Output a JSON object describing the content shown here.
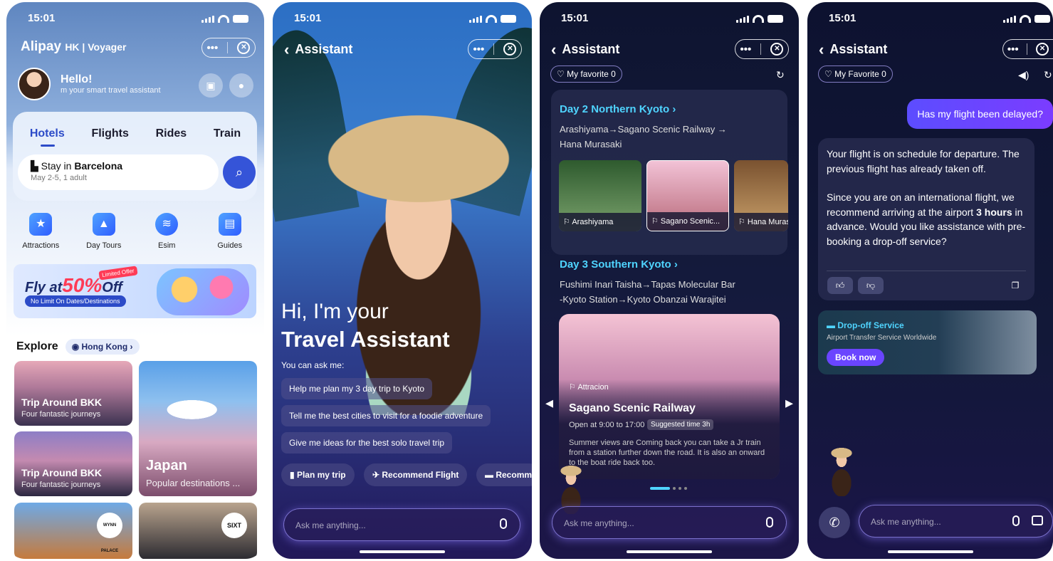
{
  "status": {
    "time": "15:01"
  },
  "screen1": {
    "brand": "Alipay",
    "brand_suffix": "HK | Voyager",
    "greeting": "Hello!",
    "greeting_sub": "m your smart travel assistant",
    "tabs": [
      "Hotels",
      "Flights",
      "Rides",
      "Train"
    ],
    "search": {
      "prefix": "Stay in ",
      "city": "Barcelona",
      "details": "May 2-5, 1 adult"
    },
    "categories": [
      {
        "label": "Attractions",
        "icon": "ticket-icon"
      },
      {
        "label": "Day Tours",
        "icon": "mountain-icon"
      },
      {
        "label": "Esim",
        "icon": "wifi-icon"
      },
      {
        "label": "Guides",
        "icon": "guide-book-icon"
      }
    ],
    "promo": {
      "text": "Fly at",
      "percent": "50%",
      "off": "Off",
      "badge": "Limited Offer",
      "sub": "No Limit On Dates/Destinations"
    },
    "explore": {
      "title": "Explore",
      "location": "Hong Kong"
    },
    "cards": [
      {
        "title": "Trip Around BKK",
        "sub": "Four fantastic journeys"
      },
      {
        "title": "Trip Around BKK",
        "sub": "Four fantastic journeys"
      },
      {
        "title": "Japan",
        "sub": "Popular destinations ..."
      }
    ],
    "logos": [
      "WYNN PALACE",
      "SIXT"
    ]
  },
  "screen2": {
    "title": "Assistant",
    "hi_line1": "Hi, I'm your",
    "hi_line2": "Travel Assistant",
    "can_ask": "You can ask me:",
    "suggestions": [
      "Help me plan my 3 day trip to Kyoto",
      "Tell me the best cities to visit for a foodie adventure",
      "Give me ideas for the best solo travel trip"
    ],
    "chips": [
      "Plan my trip",
      "Recommend Flight",
      "Recomm"
    ],
    "ask_placeholder": "Ask me anything..."
  },
  "screen3": {
    "title": "Assistant",
    "favorite": "My favorite 0",
    "day2": {
      "title": "Day 2  Northern Kyoto",
      "route1": "Arashiyama→Sagano Scenic Railway →",
      "route2": "Hana Murasaki"
    },
    "thumbs": [
      "Arashiyama",
      "Sagano Scenic...",
      "Hana Murasa"
    ],
    "day3": {
      "title": "Day 3  Southern Kyoto",
      "route1": "Fushimi Inari Taisha→Tapas Molecular Bar",
      "route2": "-Kyoto Station→Kyoto Obanzai Warajitei"
    },
    "card": {
      "tag": "Attracion",
      "title": "Sagano Scenic Railway",
      "open": "Open at 9:00 to 17:00",
      "suggested": "Suggested time 3h",
      "desc": "Summer views are Coming back you can take a Jr train from a station further down the road. It is also an onward to the boat ride back too."
    },
    "ask_placeholder": "Ask me anything..."
  },
  "screen4": {
    "title": "Assistant",
    "favorite": "My Favorite 0",
    "user_message": "Has my flight been delayed?",
    "reply_p1": "Your flight is on schedule for departure. The previous flight has already taken off.",
    "reply_p2_a": "Since you are on an international flight, we recommend arriving at the airport ",
    "reply_p2_b": "3 hours",
    "reply_p2_c": " in advance. Would you like assistance with pre-booking a drop-off service?",
    "service": {
      "title": "Drop-off Service",
      "sub": "Airport Transfer Service Worldwide",
      "button": "Book now"
    },
    "ask_placeholder": "Ask me anything..."
  },
  "colors": {
    "accent": "#3554d8",
    "cyan": "#4fd4ff",
    "purple": "#6a45ff"
  }
}
